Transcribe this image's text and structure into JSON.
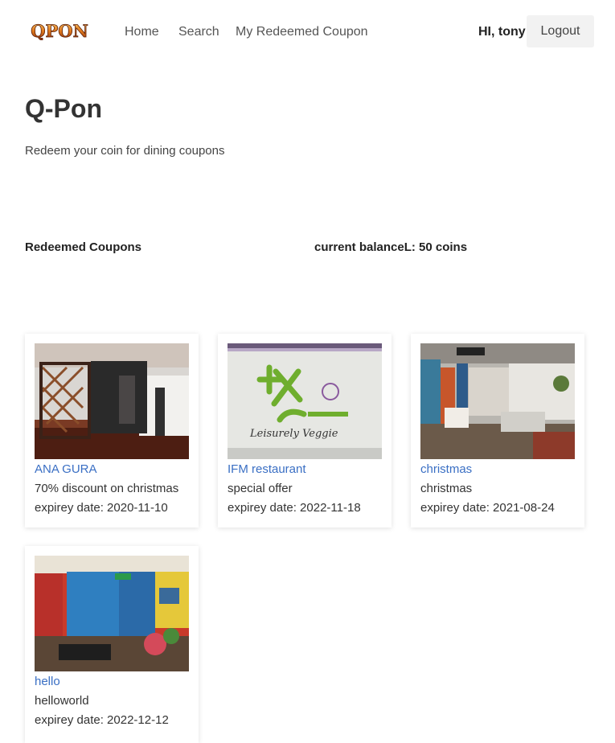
{
  "nav": {
    "logo_text": "QPON",
    "links": [
      "Home",
      "Search",
      "My Redeemed Coupon"
    ],
    "greeting": "HI, tony",
    "logout_label": "Logout"
  },
  "hero": {
    "title": "Q-Pon",
    "subtitle": "Redeem your coin for dining coupons"
  },
  "info": {
    "section_label": "Redeemed Coupons",
    "balance": "current balanceL: 50 coins"
  },
  "coupons": [
    {
      "name": "ANA GURA",
      "description": "70% discount on christmas",
      "expiry": "expirey date: 2020-11-10"
    },
    {
      "name": "IFM restaurant",
      "description": "special offer",
      "expiry": "expirey date: 2022-11-18",
      "image_text": "Leisurely Veggie"
    },
    {
      "name": "christmas",
      "description": "christmas",
      "expiry": "expirey date: 2021-08-24"
    },
    {
      "name": "hello",
      "description": "helloworld",
      "expiry": "expirey date: 2022-12-12"
    }
  ],
  "colors": {
    "link": "#3a6fc4",
    "logout_bg": "#f2f2f2",
    "logo_orange": "#d9791f"
  }
}
